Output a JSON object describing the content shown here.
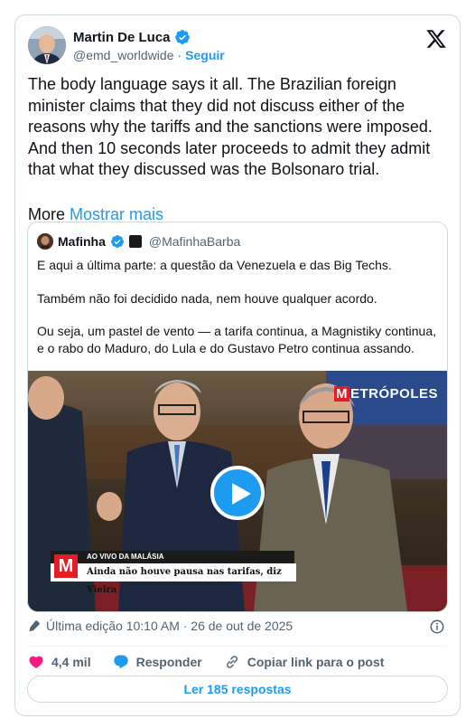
{
  "tweet": {
    "author_name": "Martin De Luca",
    "handle": "@emd_worldwide",
    "separator": "·",
    "follow_label": "Seguir",
    "text": "The body language says it all. The Brazilian foreign minister claims that they did not discuss either of the reasons why the tariffs and the sanctions were imposed. And then 10 seconds later proceeds to admit they admit that what they discussed was the Bolsonaro trial.",
    "more_label": "More",
    "show_more_label": "Mostrar mais"
  },
  "quote": {
    "author_name": "Mafinha",
    "handle": "@MafinhaBarba",
    "paragraphs": [
      "E aqui a última parte: a questão da Venezuela e das Big Techs.",
      "Também não foi decidido nada, nem houve qualquer acordo.",
      "Ou seja, um pastel de vento — a tarifa continua, a Magnistiky continua, e o rabo do Maduro, do Lula e do Gustavo Petro continua assando."
    ],
    "video": {
      "brand": "ETRÓPOLES",
      "brand_initial": "M",
      "live_tag": "AO VIVO DA MALÁSIA",
      "caption": "Ainda não houve pausa nas tarifas, diz Vieira",
      "logo_letter": "M"
    }
  },
  "meta": {
    "edited": "Última edição 10:10 AM · 26 de out de 2025"
  },
  "actions": {
    "likes": "4,4 mil",
    "reply_label": "Responder",
    "copy_link_label": "Copiar link para o post"
  },
  "read_replies_label": "Ler 185 respostas",
  "colors": {
    "accent": "#1d9bf0",
    "like": "#f91880",
    "muted": "#536471",
    "border": "#cfd9de"
  }
}
